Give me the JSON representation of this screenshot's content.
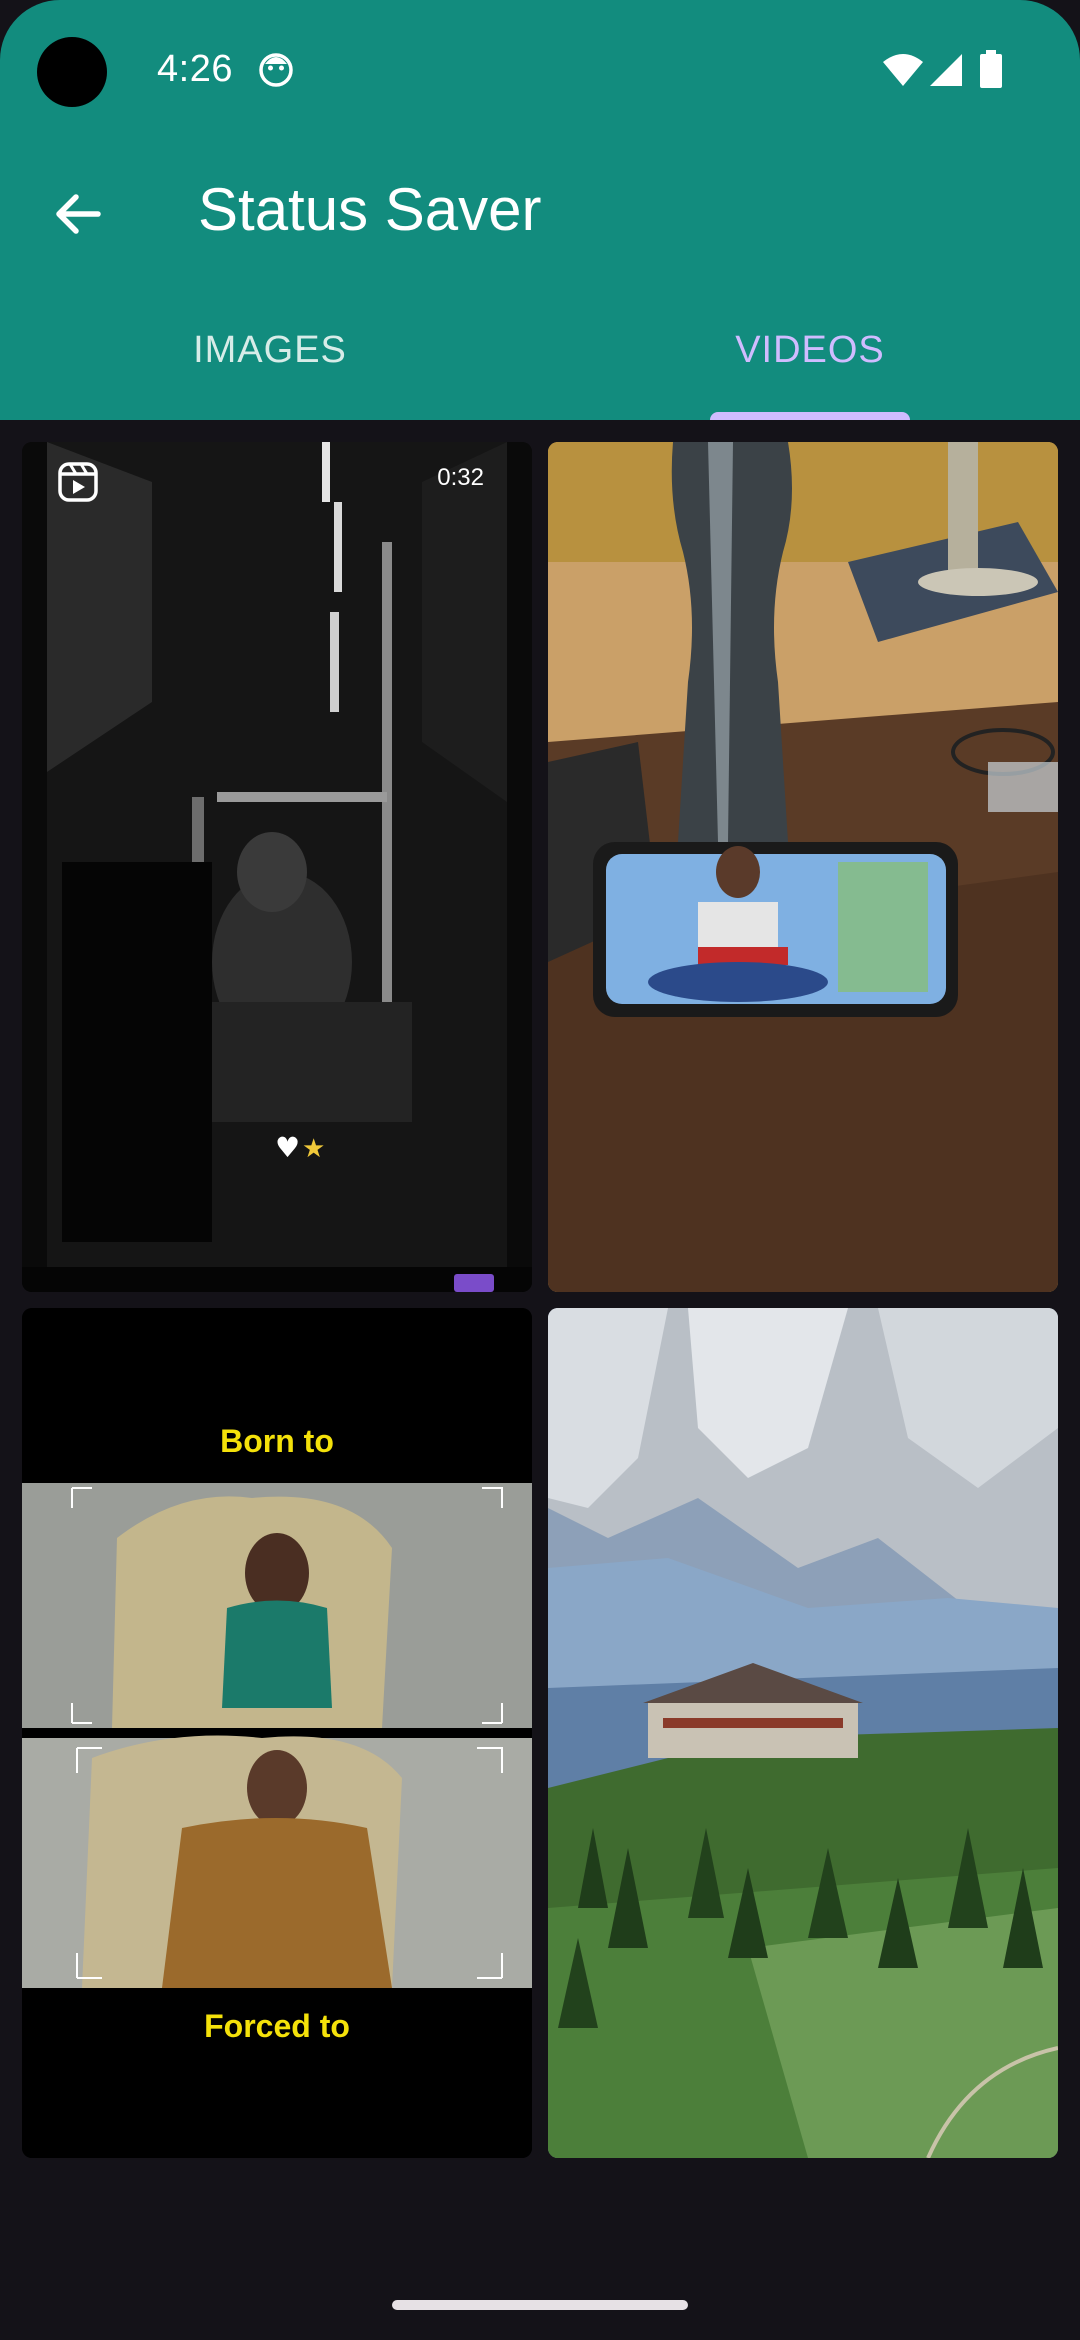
{
  "status_bar": {
    "time": "4:26"
  },
  "toolbar": {
    "title": "Status Saver"
  },
  "tabs": [
    {
      "label": "IMAGES",
      "selected": false
    },
    {
      "label": "VIDEOS",
      "selected": true
    }
  ],
  "videos": [
    {
      "duration": "0:32"
    },
    {},
    {
      "caption_top": "Born to",
      "caption_bottom": "Forced to"
    },
    {}
  ],
  "colors": {
    "app_bar": "#128C7E",
    "tab_selected": "#d0bcff",
    "background": "#141218"
  }
}
